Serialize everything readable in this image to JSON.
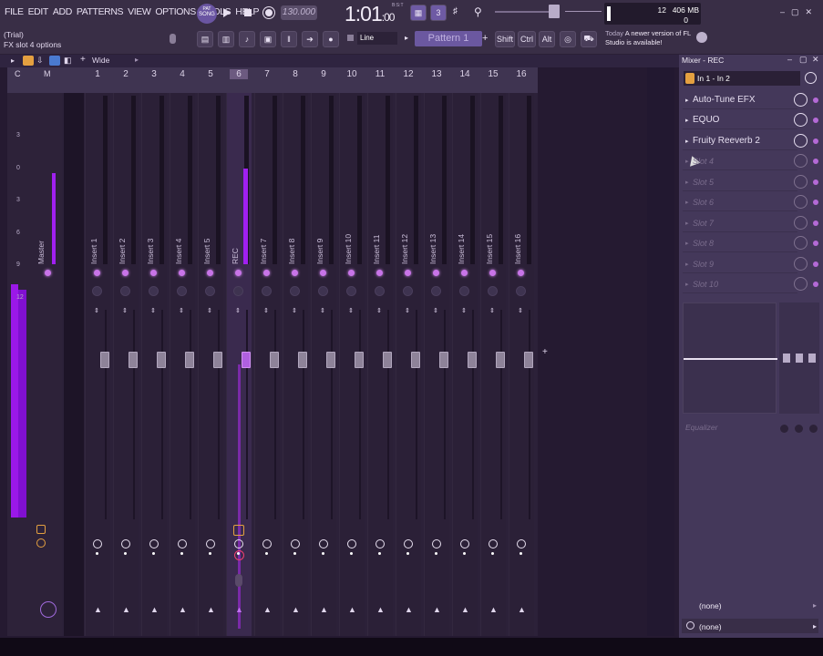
{
  "menu": [
    "FILE",
    "EDIT",
    "ADD",
    "PATTERNS",
    "VIEW",
    "OPTIONS",
    "TOOLS",
    "HELP"
  ],
  "hint": {
    "line1": "(Trial)",
    "line2": "FX slot 4 options"
  },
  "transport": {
    "mode_top": "PAT",
    "mode_bottom": "SONG",
    "tempo": "130.000",
    "time_main": "1:01",
    "time_sub": ":00",
    "bst": "B:S:T"
  },
  "cpu": {
    "value1": "12",
    "value2": "406 MB",
    "value3": "0"
  },
  "news": {
    "prefix": "Today",
    "text": "A newer version of FL Studio is available!"
  },
  "toolbar": {
    "snap": "Line",
    "pattern": "Pattern 1",
    "shift": "Shift",
    "ctrl": "Ctrl",
    "alt": "Alt"
  },
  "mixer": {
    "view_mode": "Wide",
    "master_cols": [
      "C",
      "M"
    ],
    "track_numbers": [
      "1",
      "2",
      "3",
      "4",
      "5",
      "6",
      "7",
      "8",
      "9",
      "10",
      "11",
      "12",
      "13",
      "14",
      "15",
      "16"
    ],
    "insert_labels": [
      "Insert 1",
      "Insert 2",
      "Insert 3",
      "Insert 4",
      "Insert 5",
      "REC",
      "Insert 7",
      "Insert 8",
      "Insert 9",
      "Insert 10",
      "Insert 11",
      "Insert 12",
      "Insert 13",
      "Insert 14",
      "Insert 15",
      "Insert 16"
    ],
    "master_label": "Master",
    "db_scale": [
      "3",
      "0",
      "3",
      "6",
      "9",
      "12"
    ],
    "selected_track": "6"
  },
  "panel": {
    "title": "Mixer - REC",
    "input": "In 1 - In 2",
    "slots": [
      {
        "label": "Auto-Tune EFX",
        "filled": true
      },
      {
        "label": "EQUO",
        "filled": true
      },
      {
        "label": "Fruity Reeverb 2",
        "filled": true
      },
      {
        "label": "Slot 4",
        "filled": false
      },
      {
        "label": "Slot 5",
        "filled": false
      },
      {
        "label": "Slot 6",
        "filled": false
      },
      {
        "label": "Slot 7",
        "filled": false
      },
      {
        "label": "Slot 8",
        "filled": false
      },
      {
        "label": "Slot 9",
        "filled": false
      },
      {
        "label": "Slot 10",
        "filled": false
      }
    ],
    "eq_label": "Equalizer",
    "send_top": "(none)",
    "send_bottom": "(none)"
  },
  "colors": {
    "accent": "#c874e8",
    "meter": "#a020f0",
    "panel": "#44385a"
  }
}
